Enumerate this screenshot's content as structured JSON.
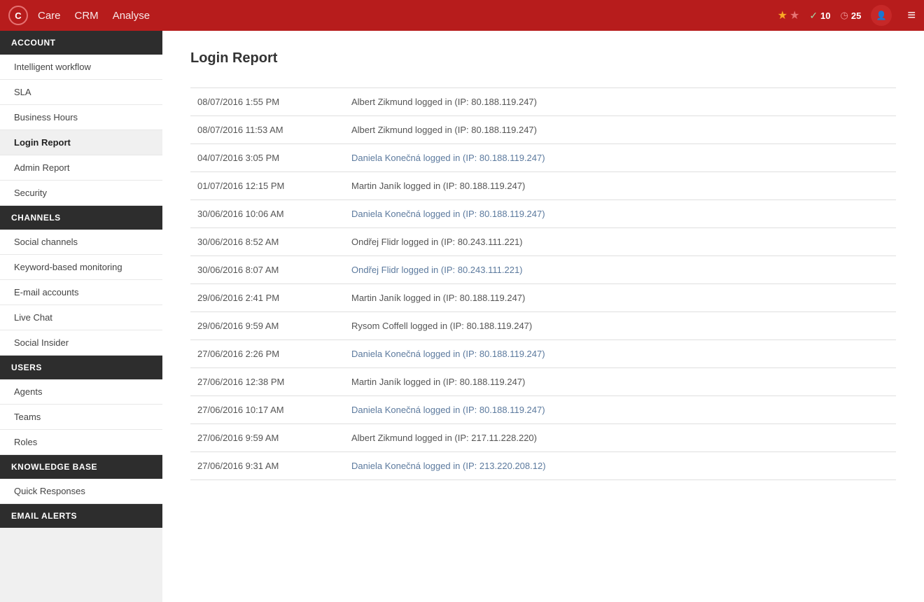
{
  "topnav": {
    "logo": "C",
    "menu": [
      {
        "label": "Care"
      },
      {
        "label": "CRM"
      },
      {
        "label": "Analyse"
      }
    ],
    "stars": [
      "★",
      "★"
    ],
    "check_count": "10",
    "clock_count": "25",
    "hamburger": "≡"
  },
  "sidebar": {
    "sections": [
      {
        "header": "ACCOUNT",
        "items": [
          {
            "label": "Intelligent workflow",
            "active": false
          },
          {
            "label": "SLA",
            "active": false
          },
          {
            "label": "Business Hours",
            "active": false
          },
          {
            "label": "Login Report",
            "active": true
          },
          {
            "label": "Admin Report",
            "active": false
          },
          {
            "label": "Security",
            "active": false
          }
        ]
      },
      {
        "header": "CHANNELS",
        "items": [
          {
            "label": "Social channels",
            "active": false
          },
          {
            "label": "Keyword-based monitoring",
            "active": false
          },
          {
            "label": "E-mail accounts",
            "active": false
          },
          {
            "label": "Live Chat",
            "active": false
          },
          {
            "label": "Social Insider",
            "active": false
          }
        ]
      },
      {
        "header": "USERS",
        "items": [
          {
            "label": "Agents",
            "active": false
          },
          {
            "label": "Teams",
            "active": false
          },
          {
            "label": "Roles",
            "active": false
          }
        ]
      },
      {
        "header": "KNOWLEDGE BASE",
        "items": [
          {
            "label": "Quick Responses",
            "active": false
          }
        ]
      },
      {
        "header": "EMAIL ALERTS",
        "items": []
      }
    ]
  },
  "content": {
    "title": "Login Report",
    "logs": [
      {
        "timestamp": "08/07/2016 1:55 PM",
        "message": "Albert Zikmund logged in (IP: 80.188.119.247)",
        "highlight": false
      },
      {
        "timestamp": "08/07/2016 11:53 AM",
        "message": "Albert Zikmund logged in (IP: 80.188.119.247)",
        "highlight": false
      },
      {
        "timestamp": "04/07/2016 3:05 PM",
        "message": "Daniela Konečná logged in (IP: 80.188.119.247)",
        "highlight": true
      },
      {
        "timestamp": "01/07/2016 12:15 PM",
        "message": "Martin Janík logged in (IP: 80.188.119.247)",
        "highlight": false
      },
      {
        "timestamp": "30/06/2016 10:06 AM",
        "message": "Daniela Konečná logged in (IP: 80.188.119.247)",
        "highlight": true
      },
      {
        "timestamp": "30/06/2016 8:52 AM",
        "message": "Ondřej Flidr logged in (IP: 80.243.111.221)",
        "highlight": false
      },
      {
        "timestamp": "30/06/2016 8:07 AM",
        "message": "Ondřej Flidr logged in (IP: 80.243.111.221)",
        "highlight": true
      },
      {
        "timestamp": "29/06/2016 2:41 PM",
        "message": "Martin Janík logged in (IP: 80.188.119.247)",
        "highlight": false
      },
      {
        "timestamp": "29/06/2016 9:59 AM",
        "message": "Rysom Coffell logged in (IP: 80.188.119.247)",
        "highlight": false
      },
      {
        "timestamp": "27/06/2016 2:26 PM",
        "message": "Daniela Konečná logged in (IP: 80.188.119.247)",
        "highlight": true
      },
      {
        "timestamp": "27/06/2016 12:38 PM",
        "message": "Martin Janík logged in (IP: 80.188.119.247)",
        "highlight": false
      },
      {
        "timestamp": "27/06/2016 10:17 AM",
        "message": "Daniela Konečná logged in (IP: 80.188.119.247)",
        "highlight": true
      },
      {
        "timestamp": "27/06/2016 9:59 AM",
        "message": "Albert Zikmund logged in (IP: 217.11.228.220)",
        "highlight": false
      },
      {
        "timestamp": "27/06/2016 9:31 AM",
        "message": "Daniela Konečná logged in (IP: 213.220.208.12)",
        "highlight": true
      }
    ]
  }
}
